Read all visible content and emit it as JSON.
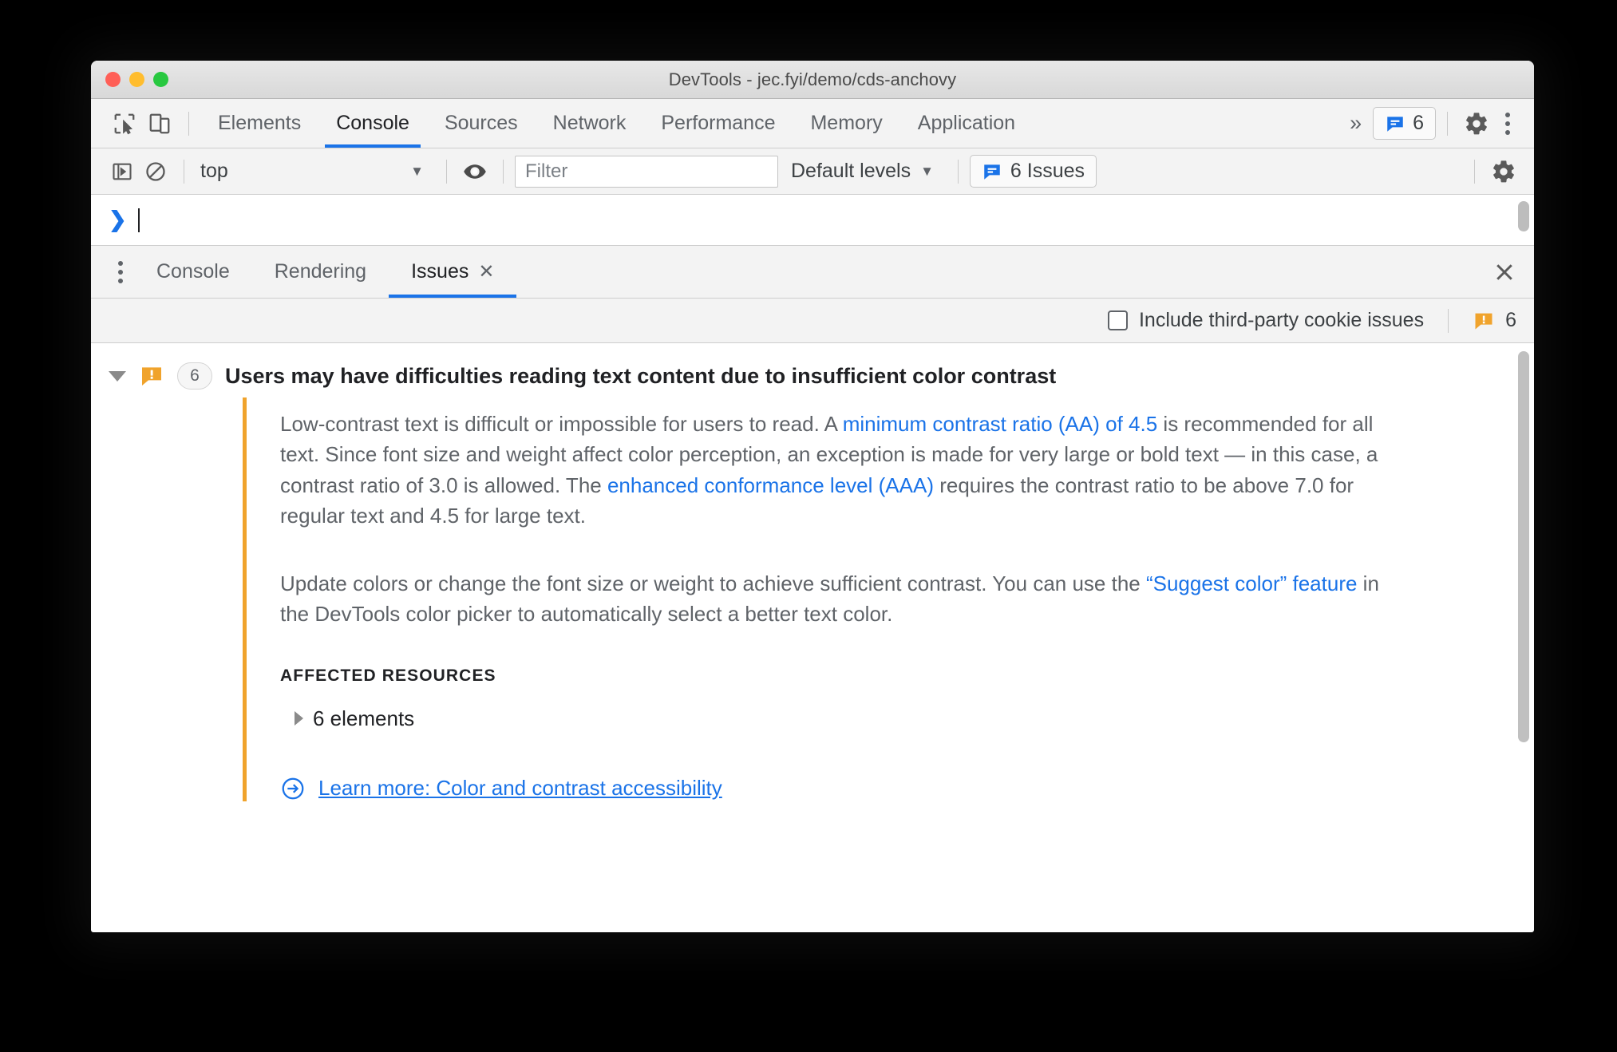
{
  "window": {
    "title": "DevTools - jec.fyi/demo/cds-anchovy",
    "traffic_lights": [
      "close-red",
      "minimize-yellow",
      "maximize-green"
    ],
    "colors": {
      "accent_blue": "#1a73e8",
      "warning_orange": "#f0a32c",
      "text": "#5f6368"
    }
  },
  "main_tabbar": {
    "icons": [
      "inspect-element-icon",
      "device-toolbar-icon"
    ],
    "tabs": [
      {
        "label": "Elements",
        "active": false
      },
      {
        "label": "Console",
        "active": true
      },
      {
        "label": "Sources",
        "active": false
      },
      {
        "label": "Network",
        "active": false
      },
      {
        "label": "Performance",
        "active": false
      },
      {
        "label": "Memory",
        "active": false
      },
      {
        "label": "Application",
        "active": false
      }
    ],
    "overflow_label": "»",
    "issues_badge": {
      "icon": "issues-message-icon",
      "count": "6"
    },
    "settings_icon": "gear-icon",
    "more_icon": "kebab-menu-icon"
  },
  "console_toolbar": {
    "sidebar_toggle_icon": "console-sidebar-icon",
    "clear_icon": "clear-console-icon",
    "context_selector": {
      "value": "top",
      "caret": "▼"
    },
    "eye_icon": "live-expression-icon",
    "filter": {
      "placeholder": "Filter",
      "value": ""
    },
    "levels": {
      "label": "Default levels",
      "caret": "▼"
    },
    "issues_button": {
      "icon": "issues-message-icon",
      "label": "6 Issues"
    },
    "settings_icon": "gear-icon"
  },
  "console_prompt": {
    "chevron": "❯",
    "value": ""
  },
  "drawer": {
    "more_icon": "kebab-menu-icon",
    "tabs": [
      {
        "label": "Console",
        "active": false,
        "closeable": false
      },
      {
        "label": "Rendering",
        "active": false,
        "closeable": false
      },
      {
        "label": "Issues",
        "active": true,
        "closeable": true,
        "close_glyph": "✕"
      }
    ],
    "close_drawer_glyph": "✕"
  },
  "issues_toolbar": {
    "checkbox": {
      "label": "Include third-party cookie issues",
      "checked": false
    },
    "warning_icon": "warning-issue-icon",
    "count": "6"
  },
  "issue": {
    "expanded": true,
    "expand_glyph": "▼",
    "icon": "warning-issue-icon",
    "count": "6",
    "title": "Users may have difficulties reading text content due to insufficient color contrast",
    "paragraph1": {
      "seg1": "Low-contrast text is difficult or impossible for users to read. A ",
      "link1": "minimum contrast ratio (AA) of 4.5",
      "seg2": " is recommended for all text. Since font size and weight affect color perception, an exception is made for very large or bold text — in this case, a contrast ratio of 3.0 is allowed. The ",
      "link2": "enhanced conformance level (AAA)",
      "seg3": " requires the contrast ratio to be above 7.0 for regular text and 4.5 for large text."
    },
    "paragraph2": {
      "seg1": "Update colors or change the font size or weight to achieve sufficient contrast. You can use the ",
      "link1": "“Suggest color” feature",
      "seg2": " in the DevTools color picker to automatically select a better text color."
    },
    "affected_resources_label": "AFFECTED RESOURCES",
    "resource_row": {
      "glyph": "▶",
      "label": "6 elements"
    },
    "learn_more": {
      "icon": "arrow-circle-right-icon",
      "label": "Learn more: Color and contrast accessibility"
    }
  }
}
